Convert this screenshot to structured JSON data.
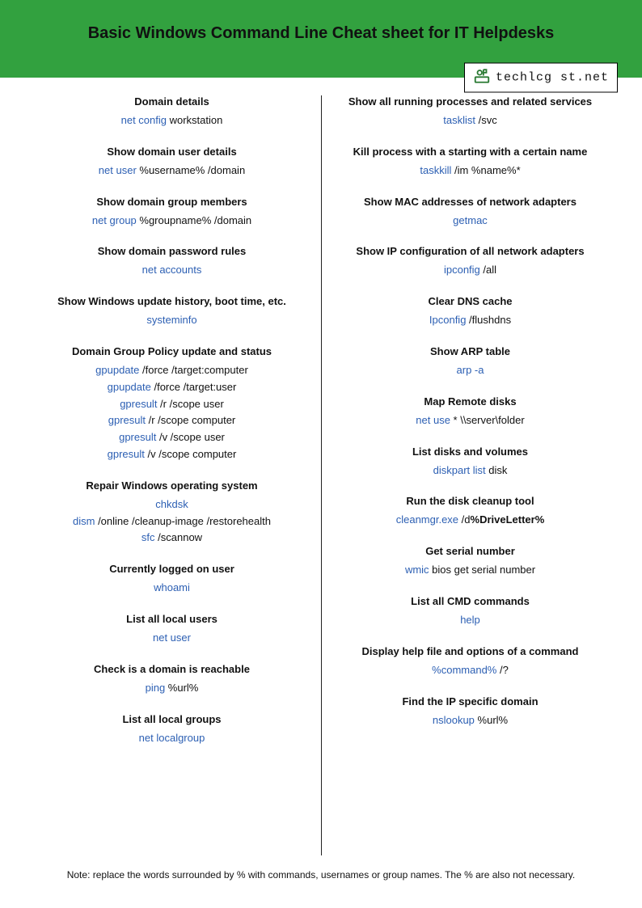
{
  "header": {
    "title": "Basic Windows Command Line Cheat sheet for IT Helpdesks",
    "logo_text": "techlcg st.net"
  },
  "columns": [
    [
      {
        "title": "Domain details",
        "lines": [
          [
            {
              "t": "net config",
              "k": true
            },
            {
              "t": " workstation",
              "k": false
            }
          ]
        ]
      },
      {
        "title": "Show domain user details",
        "lines": [
          [
            {
              "t": "net user",
              "k": true
            },
            {
              "t": " %username% /domain",
              "k": false
            }
          ]
        ]
      },
      {
        "title": "Show domain group members",
        "lines": [
          [
            {
              "t": "net group",
              "k": true
            },
            {
              "t": " %groupname% /domain",
              "k": false
            }
          ]
        ]
      },
      {
        "title": "Show domain password rules",
        "lines": [
          [
            {
              "t": "net accounts",
              "k": true
            }
          ]
        ]
      },
      {
        "title": "Show Windows update history, boot time, etc.",
        "lines": [
          [
            {
              "t": "systeminfo",
              "k": true
            }
          ]
        ]
      },
      {
        "title": "Domain Group Policy update and status",
        "lines": [
          [
            {
              "t": "gpupdate",
              "k": true
            },
            {
              "t": " /force /target:computer",
              "k": false
            }
          ],
          [
            {
              "t": "gpupdate",
              "k": true
            },
            {
              "t": " /force /target:user",
              "k": false
            }
          ],
          [
            {
              "t": "gpresult",
              "k": true
            },
            {
              "t": " /r /scope user",
              "k": false
            }
          ],
          [
            {
              "t": "gpresult",
              "k": true
            },
            {
              "t": " /r /scope computer",
              "k": false
            }
          ],
          [
            {
              "t": "gpresult",
              "k": true
            },
            {
              "t": " /v /scope user",
              "k": false
            }
          ],
          [
            {
              "t": "gpresult",
              "k": true
            },
            {
              "t": " /v /scope computer",
              "k": false
            }
          ]
        ]
      },
      {
        "title": "Repair Windows operating system",
        "lines": [
          [
            {
              "t": "chkdsk",
              "k": true
            }
          ],
          [
            {
              "t": "dism",
              "k": true
            },
            {
              "t": " /online /cleanup-image /restorehealth",
              "k": false
            }
          ],
          [
            {
              "t": "sfc",
              "k": true
            },
            {
              "t": " /scannow",
              "k": false
            }
          ]
        ]
      },
      {
        "title": "Currently logged on user",
        "lines": [
          [
            {
              "t": "whoami",
              "k": true
            }
          ]
        ]
      },
      {
        "title": "List all local users",
        "lines": [
          [
            {
              "t": "net user",
              "k": true
            }
          ]
        ]
      },
      {
        "title": "Check is a domain is reachable",
        "lines": [
          [
            {
              "t": "ping",
              "k": true
            },
            {
              "t": " %url%",
              "k": false
            }
          ]
        ]
      },
      {
        "title": "List all local groups",
        "lines": [
          [
            {
              "t": "net localgroup",
              "k": true
            }
          ]
        ]
      }
    ],
    [
      {
        "title": "Show all running processes and related services",
        "lines": [
          [
            {
              "t": "tasklist",
              "k": true
            },
            {
              "t": " /svc",
              "k": false
            }
          ]
        ]
      },
      {
        "title": "Kill process with a starting with a certain name",
        "lines": [
          [
            {
              "t": "taskkill",
              "k": true
            },
            {
              "t": " /im %name%*",
              "k": false
            }
          ]
        ]
      },
      {
        "title": "Show MAC addresses of network adapters",
        "lines": [
          [
            {
              "t": "getmac",
              "k": true
            }
          ]
        ]
      },
      {
        "title": "Show IP configuration of all network adapters",
        "lines": [
          [
            {
              "t": "ipconfig",
              "k": true
            },
            {
              "t": " /all",
              "k": false
            }
          ]
        ]
      },
      {
        "title": "Clear DNS cache",
        "lines": [
          [
            {
              "t": "Ipconfig",
              "k": true
            },
            {
              "t": " /flushdns",
              "k": false
            }
          ]
        ]
      },
      {
        "title": "Show ARP table",
        "lines": [
          [
            {
              "t": "arp -a",
              "k": true
            }
          ]
        ]
      },
      {
        "title": "Map Remote disks",
        "lines": [
          [
            {
              "t": "net use",
              "k": true
            },
            {
              "t": " * \\\\server\\folder",
              "k": false
            }
          ]
        ]
      },
      {
        "title": "List disks and volumes",
        "lines": [
          [
            {
              "t": "diskpart list",
              "k": true
            },
            {
              "t": " disk",
              "k": false
            }
          ]
        ]
      },
      {
        "title": "Run the disk cleanup tool",
        "lines": [
          [
            {
              "t": "cleanmgr.exe",
              "k": true
            },
            {
              "t": " /d",
              "k": false
            },
            {
              "t": "%DriveLetter%",
              "k": false,
              "bold": true
            }
          ]
        ]
      },
      {
        "title": "Get serial number",
        "lines": [
          [
            {
              "t": "wmic",
              "k": true
            },
            {
              "t": " bios get serial number",
              "k": false
            }
          ]
        ]
      },
      {
        "title": "List all  CMD commands",
        "lines": [
          [
            {
              "t": "help",
              "k": true
            }
          ]
        ]
      },
      {
        "title": "Display help file and options of a command",
        "lines": [
          [
            {
              "t": "%command%",
              "k": true
            },
            {
              "t": " /?",
              "k": false
            }
          ]
        ]
      },
      {
        "title": "Find the IP specific domain",
        "lines": [
          [
            {
              "t": "nslookup",
              "k": true
            },
            {
              "t": " %url%",
              "k": false
            }
          ]
        ]
      }
    ]
  ],
  "footnote": "Note: replace the words surrounded by % with commands, usernames or group names. The % are also not necessary."
}
